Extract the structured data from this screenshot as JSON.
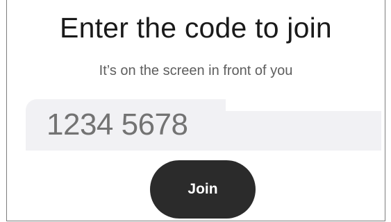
{
  "join": {
    "title": "Enter the code to join",
    "subtitle": "It’s on the screen in front of you",
    "code_input": {
      "value": "",
      "placeholder": "1234 5678"
    },
    "join_button_label": "Join"
  },
  "colors": {
    "field_background": "#f1f1f4",
    "button_background": "#2b2b2b",
    "button_text": "#ffffff",
    "title_text": "#1a1a1a",
    "subtitle_text": "#5e5e5e"
  }
}
